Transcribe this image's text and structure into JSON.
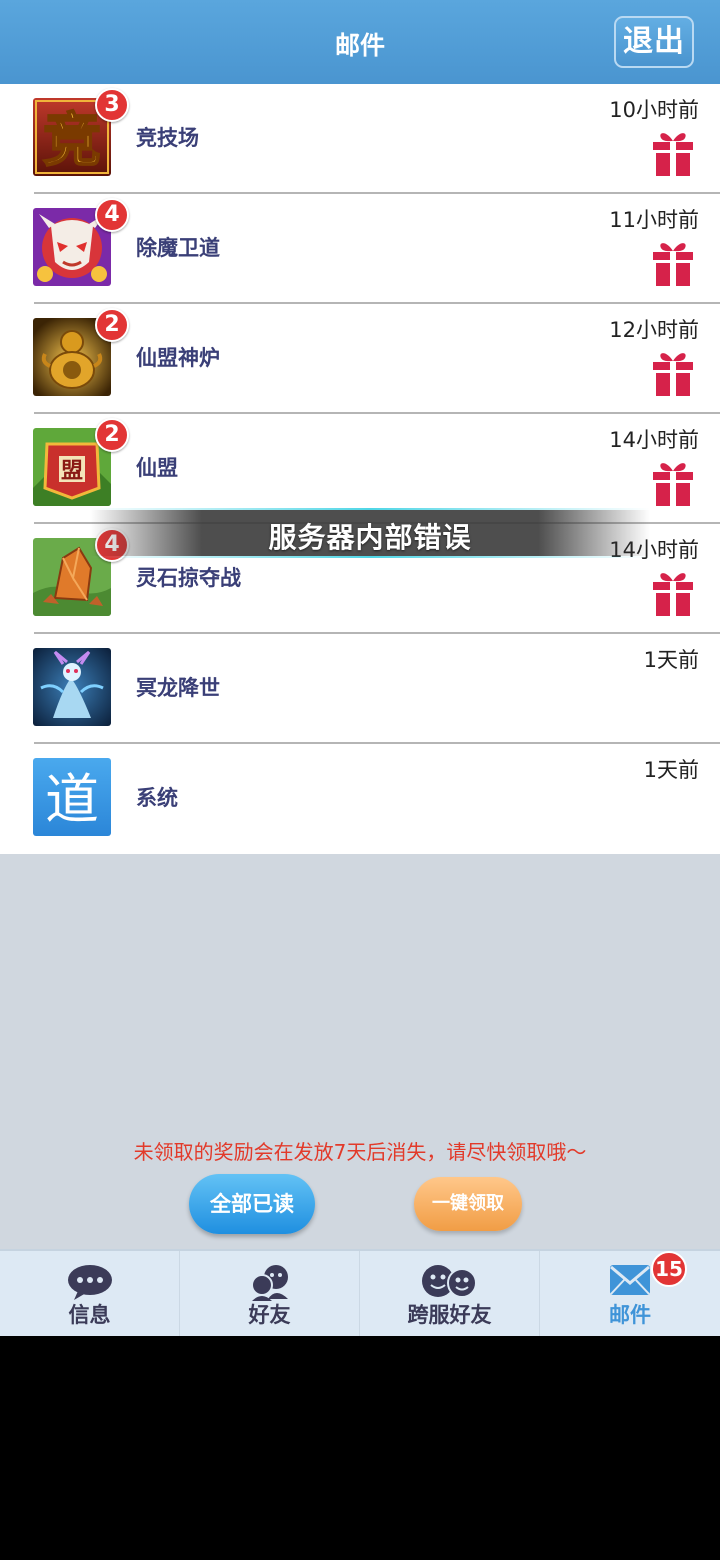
{
  "header": {
    "title": "邮件",
    "exit_label": "退出"
  },
  "mails": [
    {
      "name": "竞技场",
      "time": "10小时前",
      "badge": "3",
      "icon": "arena-icon",
      "has_gift": true
    },
    {
      "name": "除魔卫道",
      "time": "11小时前",
      "badge": "4",
      "icon": "demon-mask-icon",
      "has_gift": true
    },
    {
      "name": "仙盟神炉",
      "time": "12小时前",
      "badge": "2",
      "icon": "divine-furnace-icon",
      "has_gift": true
    },
    {
      "name": "仙盟",
      "time": "14小时前",
      "badge": "2",
      "icon": "alliance-banner-icon",
      "has_gift": true
    },
    {
      "name": "灵石掠夺战",
      "time": "14小时前",
      "badge": "4",
      "icon": "spirit-stone-icon",
      "has_gift": true
    },
    {
      "name": "冥龙降世",
      "time": "1天前",
      "badge": "",
      "icon": "dragon-icon",
      "has_gift": false
    },
    {
      "name": "系统",
      "time": "1天前",
      "badge": "",
      "icon": "dao-system-icon",
      "has_gift": false
    }
  ],
  "avatar_glyphs": {
    "arena": "竞",
    "alliance": "盟",
    "system": "道"
  },
  "toast": {
    "text": "服务器内部错误"
  },
  "footer": {
    "notice": "未领取的奖励会在发放7天后消失，请尽快领取哦～",
    "read_all_label": "全部已读",
    "claim_all_label": "一键领取"
  },
  "nav": {
    "tabs": [
      {
        "label": "信息",
        "icon": "chat-bubble-icon"
      },
      {
        "label": "好友",
        "icon": "friends-icon"
      },
      {
        "label": "跨服好友",
        "icon": "cross-server-friends-icon"
      },
      {
        "label": "邮件",
        "icon": "mail-icon",
        "active": true
      }
    ],
    "mail_badge": "15"
  },
  "colors": {
    "header": "#4a95d0",
    "badge": "#e23535",
    "notice": "#e23a2a",
    "active_tab": "#3f94d8",
    "gift": "#d6224a"
  }
}
